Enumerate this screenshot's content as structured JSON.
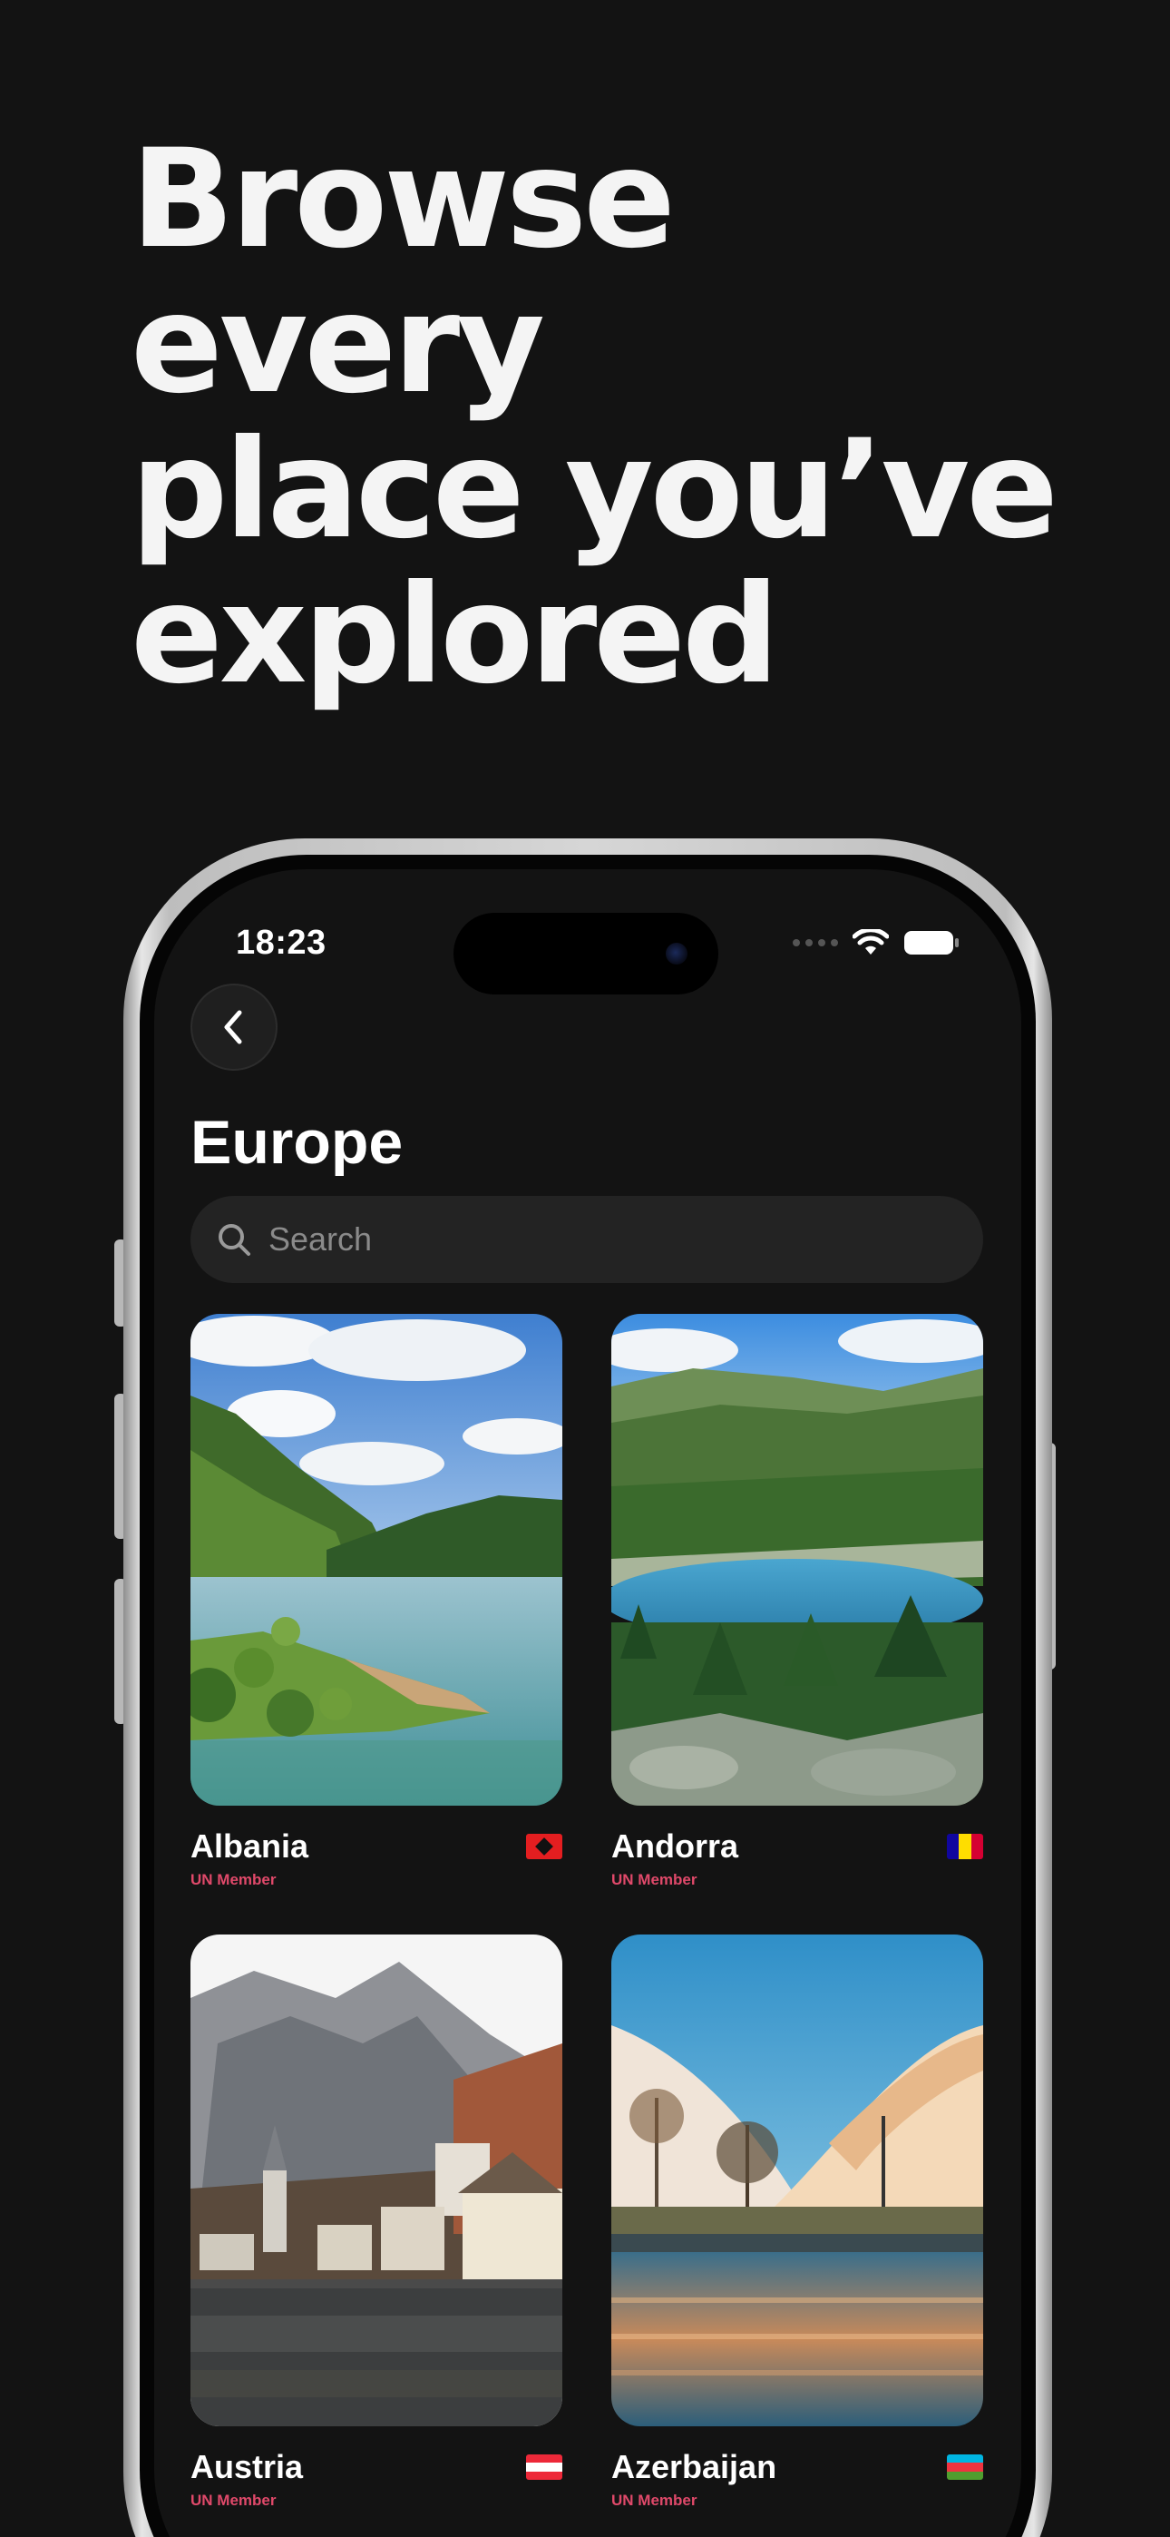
{
  "headline": {
    "lines": [
      "Browse every",
      "place you’ve",
      "explored"
    ]
  },
  "status_bar": {
    "time": "18:23"
  },
  "header": {
    "title": "Europe"
  },
  "search": {
    "placeholder": "Search"
  },
  "countries": [
    {
      "name": "Albania",
      "subtitle": "UN Member",
      "flag_colors": [
        "#e41e20",
        "#000000"
      ]
    },
    {
      "name": "Andorra",
      "subtitle": "UN Member",
      "flag_colors": [
        "#10069f",
        "#fedd00",
        "#d50032"
      ]
    },
    {
      "name": "Austria",
      "subtitle": "UN Member",
      "flag_colors": [
        "#ed2939",
        "#ffffff",
        "#ed2939"
      ]
    },
    {
      "name": "Azerbaijan",
      "subtitle": "UN Member",
      "flag_colors": [
        "#00b5e2",
        "#ef3340",
        "#509e2f"
      ]
    }
  ],
  "colors": {
    "background": "#131313",
    "accent": "#e0496a",
    "search_bg": "#232323"
  },
  "icons": {
    "back": "chevron-left-icon",
    "search": "search-icon",
    "wifi": "wifi-icon",
    "battery": "battery-icon"
  }
}
